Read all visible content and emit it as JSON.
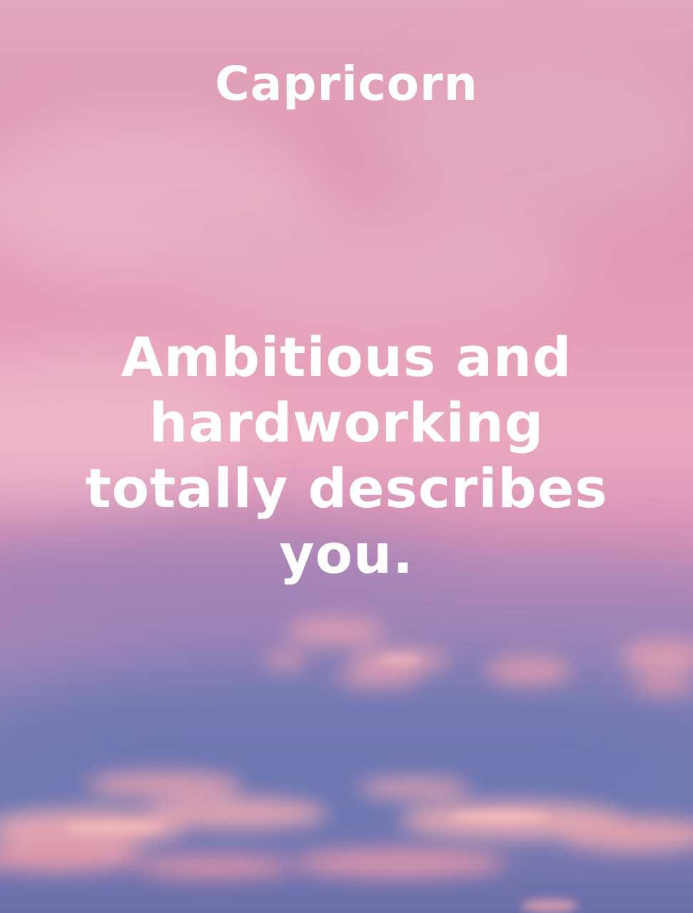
{
  "title": "Capricorn",
  "message_lines": [
    "Ambitious and",
    "hardworking",
    "totally describes",
    "you."
  ],
  "colors": {
    "text": "#ffffff",
    "sky_pink": "#e39bb6",
    "sky_blue": "#6f7ab3",
    "cloud_glow": "#f0a0a8"
  }
}
